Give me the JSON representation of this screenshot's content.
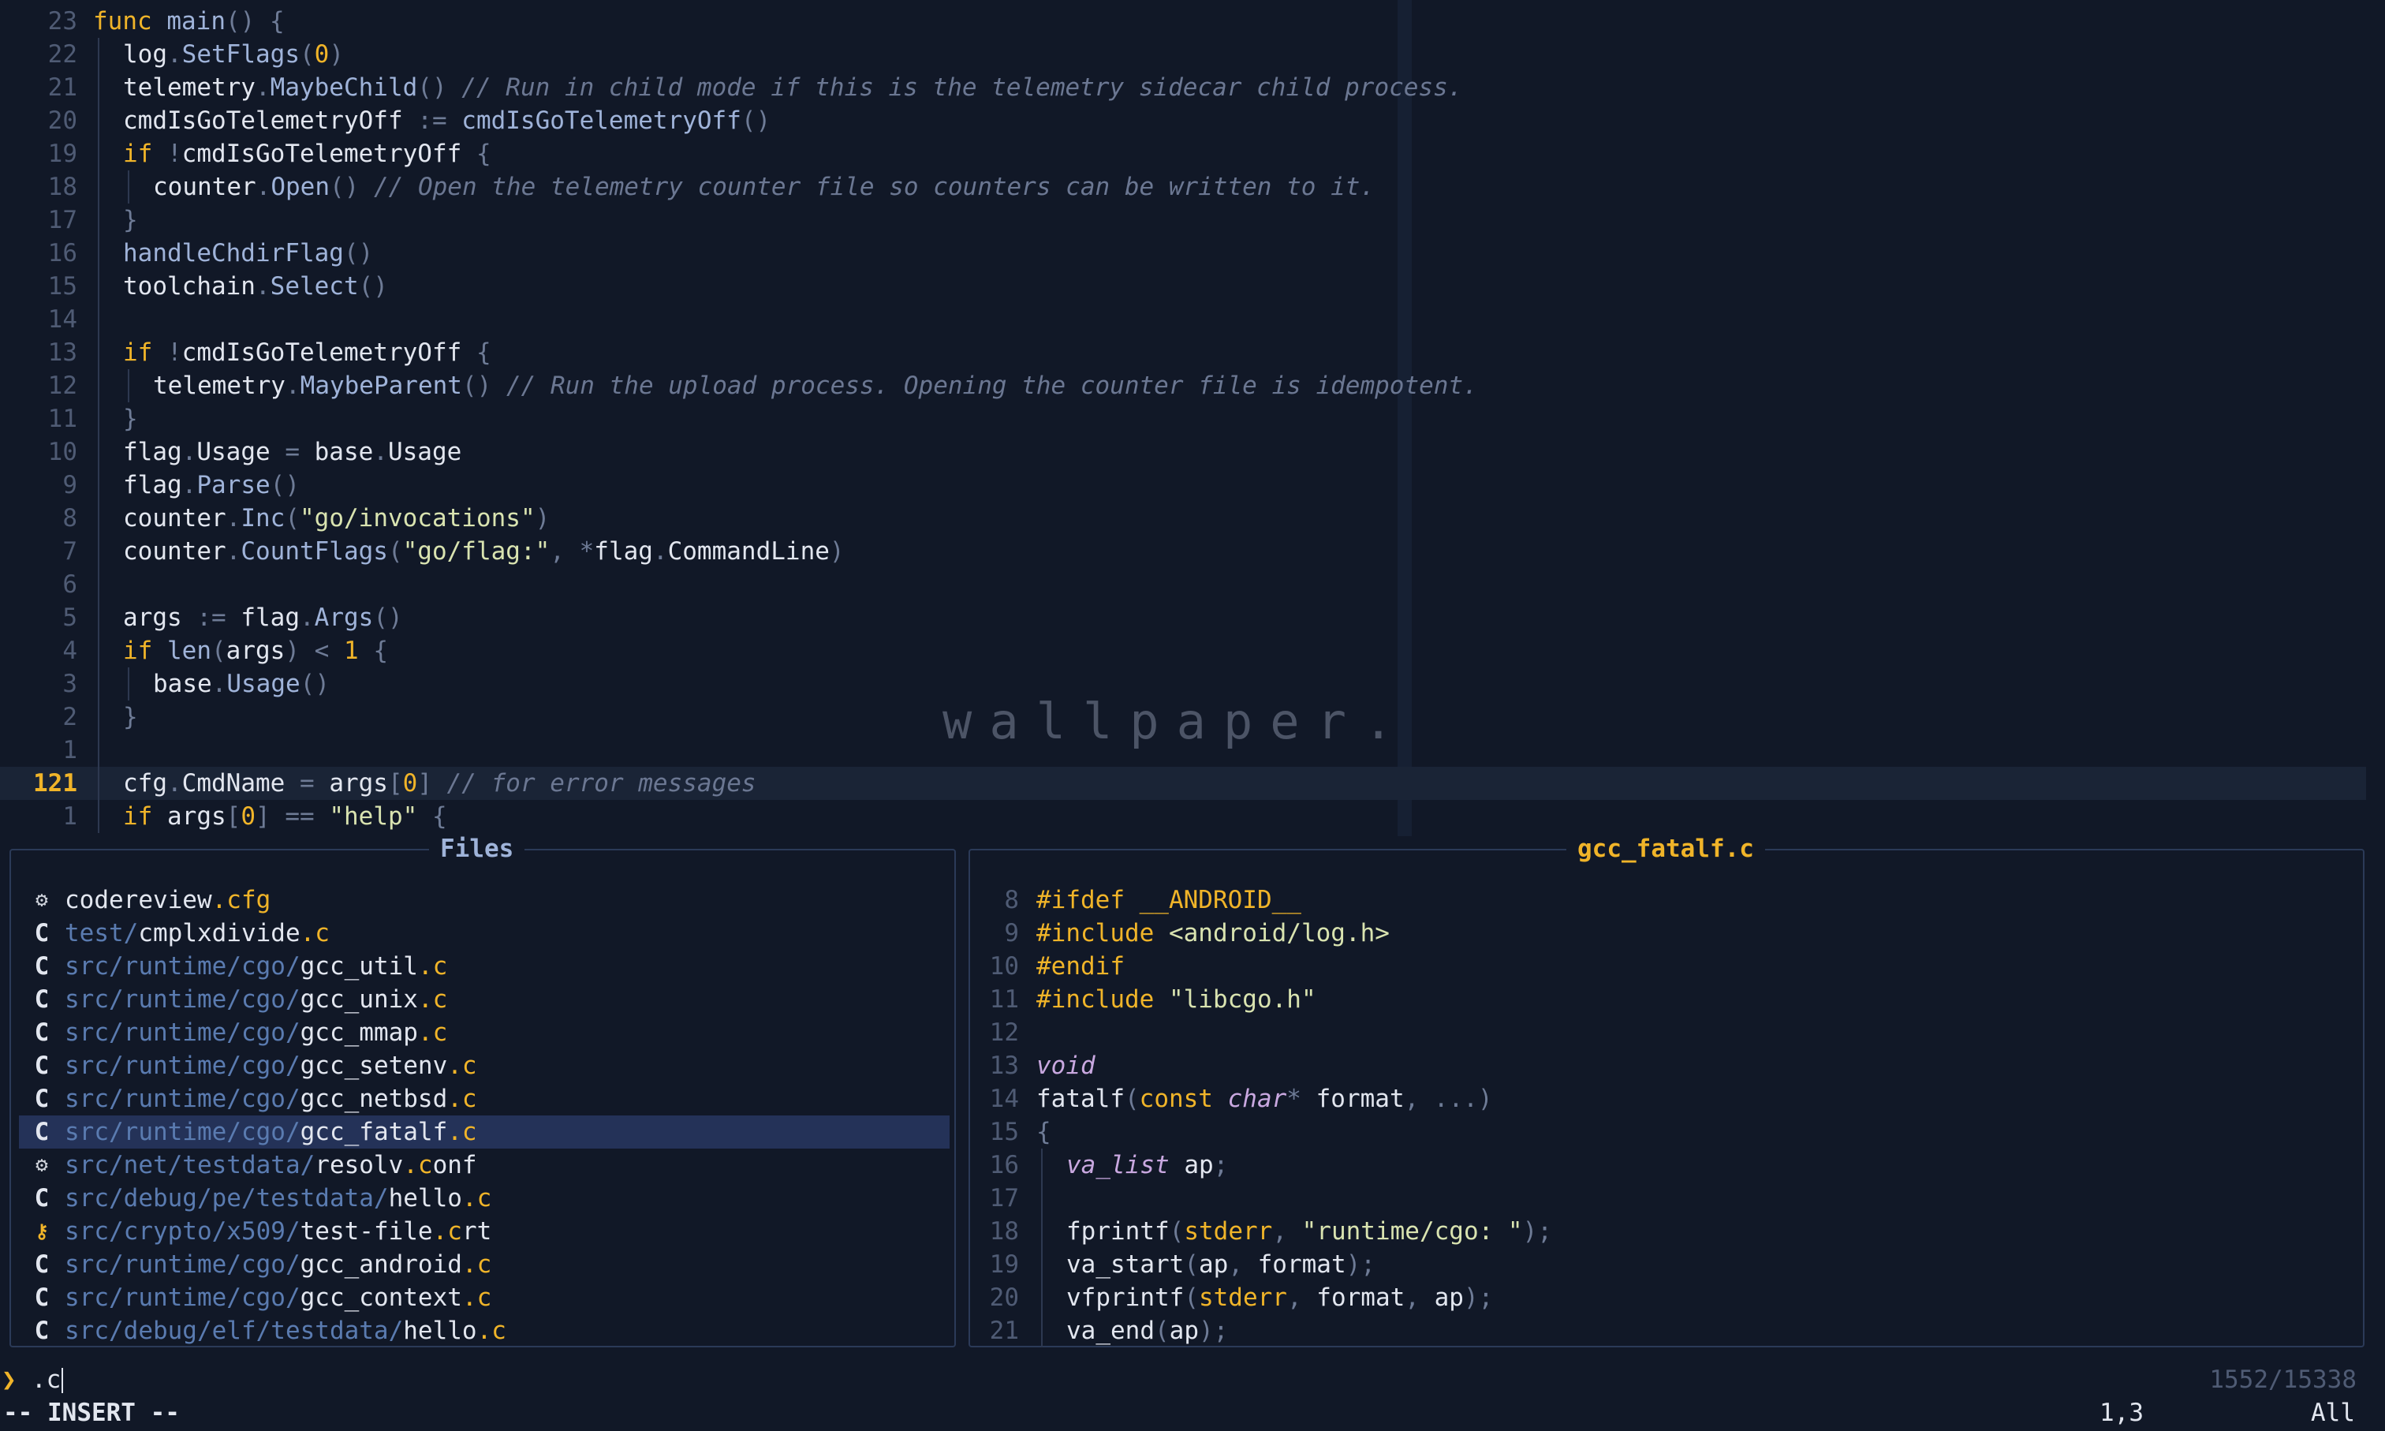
{
  "editor": {
    "lines": [
      {
        "num": "23",
        "tokens": [
          [
            "kw",
            "func "
          ],
          [
            "fn",
            "main"
          ],
          [
            "pu",
            "() {"
          ]
        ]
      },
      {
        "num": "22",
        "indent": 1,
        "tokens": [
          [
            "pl",
            "log"
          ],
          [
            "pu",
            "."
          ],
          [
            "fn",
            "SetFlags"
          ],
          [
            "pu",
            "("
          ],
          [
            "num",
            "0"
          ],
          [
            "pu",
            ")"
          ]
        ]
      },
      {
        "num": "21",
        "indent": 1,
        "tokens": [
          [
            "pl",
            "telemetry"
          ],
          [
            "pu",
            "."
          ],
          [
            "fn",
            "MaybeChild"
          ],
          [
            "pu",
            "() "
          ],
          [
            "cm",
            "// Run in child mode if this is the telemetry sidecar child process."
          ]
        ]
      },
      {
        "num": "20",
        "indent": 1,
        "tokens": [
          [
            "pl",
            "cmdIsGoTelemetryOff "
          ],
          [
            "pu",
            ":= "
          ],
          [
            "fn",
            "cmdIsGoTelemetryOff"
          ],
          [
            "pu",
            "()"
          ]
        ]
      },
      {
        "num": "19",
        "indent": 1,
        "tokens": [
          [
            "kw",
            "if "
          ],
          [
            "pu",
            "!"
          ],
          [
            "pl",
            "cmdIsGoTelemetryOff "
          ],
          [
            "pu",
            "{"
          ]
        ]
      },
      {
        "num": "18",
        "indent": 2,
        "tokens": [
          [
            "pl",
            "counter"
          ],
          [
            "pu",
            "."
          ],
          [
            "fn",
            "Open"
          ],
          [
            "pu",
            "() "
          ],
          [
            "cm",
            "// Open the telemetry counter file so counters can be written to it."
          ]
        ]
      },
      {
        "num": "17",
        "indent": 1,
        "tokens": [
          [
            "pu",
            "}"
          ]
        ]
      },
      {
        "num": "16",
        "indent": 1,
        "tokens": [
          [
            "fn",
            "handleChdirFlag"
          ],
          [
            "pu",
            "()"
          ]
        ]
      },
      {
        "num": "15",
        "indent": 1,
        "tokens": [
          [
            "pl",
            "toolchain"
          ],
          [
            "pu",
            "."
          ],
          [
            "fn",
            "Select"
          ],
          [
            "pu",
            "()"
          ]
        ]
      },
      {
        "num": "14",
        "indent": 1,
        "tokens": []
      },
      {
        "num": "13",
        "indent": 1,
        "tokens": [
          [
            "kw",
            "if "
          ],
          [
            "pu",
            "!"
          ],
          [
            "pl",
            "cmdIsGoTelemetryOff "
          ],
          [
            "pu",
            "{"
          ]
        ]
      },
      {
        "num": "12",
        "indent": 2,
        "tokens": [
          [
            "pl",
            "telemetry"
          ],
          [
            "pu",
            "."
          ],
          [
            "fn",
            "MaybeParent"
          ],
          [
            "pu",
            "() "
          ],
          [
            "cm",
            "// Run the upload process. Opening the counter file is idempotent."
          ]
        ]
      },
      {
        "num": "11",
        "indent": 1,
        "tokens": [
          [
            "pu",
            "}"
          ]
        ]
      },
      {
        "num": "10",
        "indent": 1,
        "tokens": [
          [
            "pl",
            "flag"
          ],
          [
            "pu",
            "."
          ],
          [
            "pl",
            "Usage "
          ],
          [
            "pu",
            "= "
          ],
          [
            "pl",
            "base"
          ],
          [
            "pu",
            "."
          ],
          [
            "pl",
            "Usage"
          ]
        ]
      },
      {
        "num": "9",
        "indent": 1,
        "tokens": [
          [
            "pl",
            "flag"
          ],
          [
            "pu",
            "."
          ],
          [
            "fn",
            "Parse"
          ],
          [
            "pu",
            "()"
          ]
        ]
      },
      {
        "num": "8",
        "indent": 1,
        "tokens": [
          [
            "pl",
            "counter"
          ],
          [
            "pu",
            "."
          ],
          [
            "fn",
            "Inc"
          ],
          [
            "pu",
            "("
          ],
          [
            "str",
            "\"go/invocations\""
          ],
          [
            "pu",
            ")"
          ]
        ]
      },
      {
        "num": "7",
        "indent": 1,
        "tokens": [
          [
            "pl",
            "counter"
          ],
          [
            "pu",
            "."
          ],
          [
            "fn",
            "CountFlags"
          ],
          [
            "pu",
            "("
          ],
          [
            "str",
            "\"go/flag:\""
          ],
          [
            "pu",
            ", *"
          ],
          [
            "pl",
            "flag"
          ],
          [
            "pu",
            "."
          ],
          [
            "pl",
            "CommandLine"
          ],
          [
            "pu",
            ")"
          ]
        ]
      },
      {
        "num": "6",
        "indent": 1,
        "tokens": []
      },
      {
        "num": "5",
        "indent": 1,
        "tokens": [
          [
            "pl",
            "args "
          ],
          [
            "pu",
            ":= "
          ],
          [
            "pl",
            "flag"
          ],
          [
            "pu",
            "."
          ],
          [
            "fn",
            "Args"
          ],
          [
            "pu",
            "()"
          ]
        ]
      },
      {
        "num": "4",
        "indent": 1,
        "tokens": [
          [
            "kw",
            "if "
          ],
          [
            "fn",
            "len"
          ],
          [
            "pu",
            "("
          ],
          [
            "pl",
            "args"
          ],
          [
            "pu",
            ") < "
          ],
          [
            "num",
            "1"
          ],
          [
            "pu",
            " {"
          ]
        ]
      },
      {
        "num": "3",
        "indent": 2,
        "tokens": [
          [
            "pl",
            "base"
          ],
          [
            "pu",
            "."
          ],
          [
            "fn",
            "Usage"
          ],
          [
            "pu",
            "()"
          ]
        ]
      },
      {
        "num": "2",
        "indent": 1,
        "tokens": [
          [
            "pu",
            "}"
          ]
        ]
      },
      {
        "num": "1",
        "indent": 1,
        "tokens": []
      },
      {
        "num": "121",
        "current": true,
        "indent": 1,
        "tokens": [
          [
            "pl",
            "cfg"
          ],
          [
            "pu",
            "."
          ],
          [
            "pl",
            "CmdName "
          ],
          [
            "pu",
            "= "
          ],
          [
            "pl",
            "args"
          ],
          [
            "pu",
            "["
          ],
          [
            "num",
            "0"
          ],
          [
            "pu",
            "] "
          ],
          [
            "cm",
            "// for error messages"
          ]
        ]
      },
      {
        "num": "1",
        "indent": 1,
        "tokens": [
          [
            "kw",
            "if "
          ],
          [
            "pl",
            "args"
          ],
          [
            "pu",
            "["
          ],
          [
            "num",
            "0"
          ],
          [
            "pu",
            "] == "
          ],
          [
            "str",
            "\"help\""
          ],
          [
            "pu",
            " {"
          ]
        ]
      }
    ],
    "watermark": "wallpaper."
  },
  "files_panel": {
    "title": "Files",
    "items": [
      {
        "icon": "gear-icon",
        "glyph": "⚙",
        "dir": "",
        "base": "codereview",
        "ext": ".cfg",
        "ext_plain": false
      },
      {
        "icon": "c-file-icon",
        "glyph": "C",
        "dir": "test/",
        "base": "cmplxdivide",
        "ext": ".c"
      },
      {
        "icon": "c-file-icon",
        "glyph": "C",
        "dir": "src/runtime/cgo/",
        "base": "gcc_util",
        "ext": ".c"
      },
      {
        "icon": "c-file-icon",
        "glyph": "C",
        "dir": "src/runtime/cgo/",
        "base": "gcc_unix",
        "ext": ".c"
      },
      {
        "icon": "c-file-icon",
        "glyph": "C",
        "dir": "src/runtime/cgo/",
        "base": "gcc_mmap",
        "ext": ".c"
      },
      {
        "icon": "c-file-icon",
        "glyph": "C",
        "dir": "src/runtime/cgo/",
        "base": "gcc_setenv",
        "ext": ".c"
      },
      {
        "icon": "c-file-icon",
        "glyph": "C",
        "dir": "src/runtime/cgo/",
        "base": "gcc_netbsd",
        "ext": ".c"
      },
      {
        "icon": "c-file-icon",
        "glyph": "C",
        "dir": "src/runtime/cgo/",
        "base": "gcc_fatalf",
        "ext": ".c",
        "selected": true
      },
      {
        "icon": "gear-icon",
        "glyph": "⚙",
        "dir": "src/net/testdata/",
        "base": "resolv",
        "ext": ".c",
        "ext_rest": "onf"
      },
      {
        "icon": "c-file-icon",
        "glyph": "C",
        "dir": "src/debug/pe/testdata/",
        "base": "hello",
        "ext": ".c"
      },
      {
        "icon": "key-icon",
        "glyph": "⚷",
        "dir": "src/crypto/x509/",
        "base": "test-file",
        "ext": ".c",
        "ext_rest": "rt"
      },
      {
        "icon": "c-file-icon",
        "glyph": "C",
        "dir": "src/runtime/cgo/",
        "base": "gcc_android",
        "ext": ".c"
      },
      {
        "icon": "c-file-icon",
        "glyph": "C",
        "dir": "src/runtime/cgo/",
        "base": "gcc_context",
        "ext": ".c"
      },
      {
        "icon": "c-file-icon",
        "glyph": "C",
        "dir": "src/debug/elf/testdata/",
        "base": "hello",
        "ext": ".c"
      }
    ]
  },
  "preview_panel": {
    "title": "gcc_fatalf.c",
    "lines": [
      {
        "num": "8",
        "tokens": [
          [
            "pp",
            "#ifdef __ANDROID__"
          ]
        ]
      },
      {
        "num": "9",
        "tokens": [
          [
            "pp",
            "#include "
          ],
          [
            "str",
            "<android/log.h>"
          ]
        ]
      },
      {
        "num": "10",
        "tokens": [
          [
            "pp",
            "#endif"
          ]
        ]
      },
      {
        "num": "11",
        "tokens": [
          [
            "pp",
            "#include "
          ],
          [
            "str",
            "\"libcgo.h\""
          ]
        ]
      },
      {
        "num": "12",
        "tokens": []
      },
      {
        "num": "13",
        "tokens": [
          [
            "ty",
            "void"
          ]
        ]
      },
      {
        "num": "14",
        "tokens": [
          [
            "pl",
            "fatalf"
          ],
          [
            "pu",
            "("
          ],
          [
            "kw",
            "const "
          ],
          [
            "ty",
            "char"
          ],
          [
            "pu",
            "* "
          ],
          [
            "pl",
            "format"
          ],
          [
            "pu",
            ", ...)"
          ]
        ]
      },
      {
        "num": "15",
        "tokens": [
          [
            "pu",
            "{"
          ]
        ]
      },
      {
        "num": "16",
        "indent": 1,
        "tokens": [
          [
            "ty",
            "va_list "
          ],
          [
            "pl",
            "ap"
          ],
          [
            "pu",
            ";"
          ]
        ]
      },
      {
        "num": "17",
        "indent": 1,
        "tokens": []
      },
      {
        "num": "18",
        "indent": 1,
        "tokens": [
          [
            "pl",
            "fprintf"
          ],
          [
            "pu",
            "("
          ],
          [
            "kw",
            "stderr"
          ],
          [
            "pu",
            ", "
          ],
          [
            "str",
            "\"runtime/cgo: \""
          ],
          [
            "pu",
            ");"
          ]
        ]
      },
      {
        "num": "19",
        "indent": 1,
        "tokens": [
          [
            "pl",
            "va_start"
          ],
          [
            "pu",
            "("
          ],
          [
            "pl",
            "ap"
          ],
          [
            "pu",
            ", "
          ],
          [
            "pl",
            "format"
          ],
          [
            "pu",
            ");"
          ]
        ]
      },
      {
        "num": "20",
        "indent": 1,
        "tokens": [
          [
            "pl",
            "vfprintf"
          ],
          [
            "pu",
            "("
          ],
          [
            "kw",
            "stderr"
          ],
          [
            "pu",
            ", "
          ],
          [
            "pl",
            "format"
          ],
          [
            "pu",
            ", "
          ],
          [
            "pl",
            "ap"
          ],
          [
            "pu",
            ");"
          ]
        ]
      },
      {
        "num": "21",
        "indent": 1,
        "tokens": [
          [
            "pl",
            "va_end"
          ],
          [
            "pu",
            "("
          ],
          [
            "pl",
            "ap"
          ],
          [
            "pu",
            ");"
          ]
        ]
      }
    ]
  },
  "prompt": {
    "icon": "❯",
    "query": ".c",
    "counter": "1552/15338"
  },
  "status": {
    "mode": "-- INSERT --",
    "position": "1,3",
    "scroll": "All"
  },
  "colors": {
    "background": "#111827",
    "accent": "#f0b429",
    "border": "#2b3a58",
    "selection": "#243258"
  }
}
